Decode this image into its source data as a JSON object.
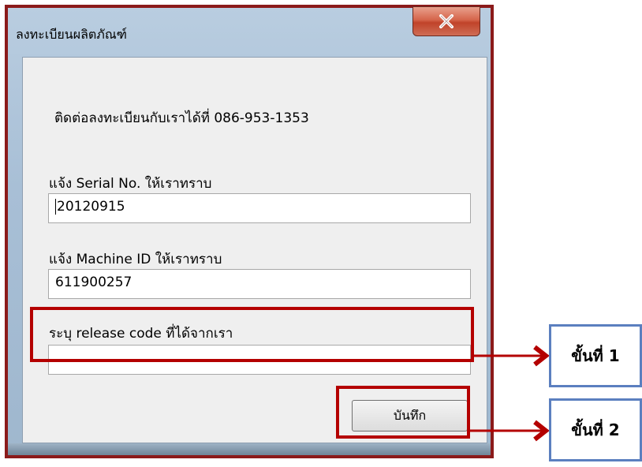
{
  "window": {
    "title": "ลงทะเบียนผลิตภัณฑ์",
    "close_icon": "close-icon"
  },
  "contact": {
    "text": "ติดต่อลงทะเบียนกับเราได้ที่ 086-953-1353"
  },
  "serial": {
    "label": "แจ้ง Serial No. ให้เราทราบ",
    "value": "20120915"
  },
  "machine": {
    "label": "แจ้ง Machine ID ให้เราทราบ",
    "value": "611900257"
  },
  "release": {
    "label": "ระบุ release code ที่ได้จากเรา",
    "value": ""
  },
  "buttons": {
    "save_label": "บันทึก"
  },
  "steps": [
    {
      "label": "ขั้นที่ 1"
    },
    {
      "label": "ขั้นที่ 2"
    }
  ],
  "colors": {
    "highlight": "#b40000",
    "step_border": "#5b7fbf",
    "arrow": "#b40000"
  }
}
